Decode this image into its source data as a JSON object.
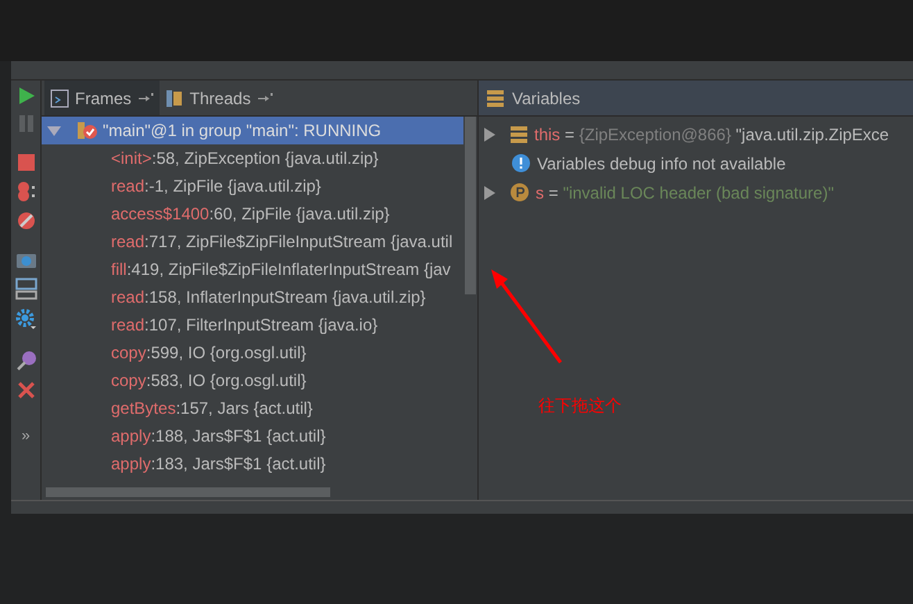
{
  "toolbar": {
    "more": "»"
  },
  "tabs": [
    {
      "label": "Frames",
      "selected": true
    },
    {
      "label": "Threads",
      "selected": false
    }
  ],
  "thread": {
    "label": "\"main\"@1 in group \"main\": RUNNING",
    "expanded": true,
    "selected": true
  },
  "frames": [
    {
      "method": "<init>",
      "location": ":58, ZipException {java.util.zip}"
    },
    {
      "method": "read",
      "location": ":-1, ZipFile {java.util.zip}"
    },
    {
      "method": "access$1400",
      "location": ":60, ZipFile {java.util.zip}"
    },
    {
      "method": "read",
      "location": ":717, ZipFile$ZipFileInputStream {java.util"
    },
    {
      "method": "fill",
      "location": ":419, ZipFile$ZipFileInflaterInputStream {jav"
    },
    {
      "method": "read",
      "location": ":158, InflaterInputStream {java.util.zip}"
    },
    {
      "method": "read",
      "location": ":107, FilterInputStream {java.io}"
    },
    {
      "method": "copy",
      "location": ":599, IO {org.osgl.util}"
    },
    {
      "method": "copy",
      "location": ":583, IO {org.osgl.util}"
    },
    {
      "method": "getBytes",
      "location": ":157, Jars {act.util}"
    },
    {
      "method": "apply",
      "location": ":188, Jars$F$1 {act.util}"
    },
    {
      "method": "apply",
      "location": ":183, Jars$F$1 {act.util}"
    }
  ],
  "variables": {
    "title": "Variables",
    "items": [
      {
        "kind": "object",
        "name": "this",
        "operator": "=",
        "type_text": "{ZipException@866}",
        "value": "\"java.util.zip.ZipExce"
      },
      {
        "kind": "info",
        "text": "Variables debug info not available"
      },
      {
        "kind": "param",
        "name": "s",
        "operator": "=",
        "value": "\"invalid LOC header (bad signature)\""
      }
    ]
  },
  "annotation": {
    "text": "往下拖这个"
  }
}
